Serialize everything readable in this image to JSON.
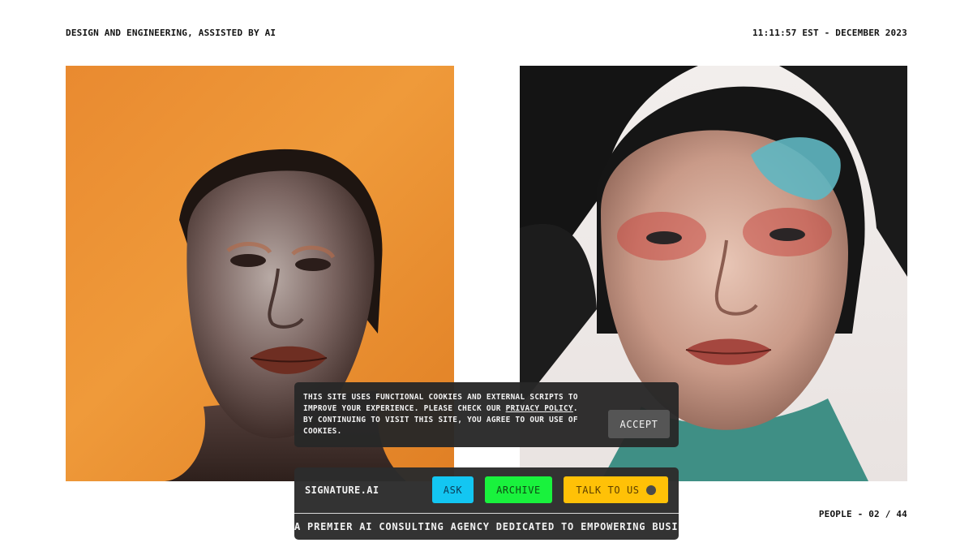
{
  "header": {
    "tagline": "DESIGN AND ENGINEERING, ASSISTED BY AI",
    "clock": "11:11:57 EST - DECEMBER 2023"
  },
  "gallery": {
    "counter": "PEOPLE - 02 / 44",
    "left_background": "#eb8f33",
    "right_background": "#f0ebe9"
  },
  "cookie": {
    "line1": "THIS SITE USES FUNCTIONAL COOKIES AND EXTERNAL SCRIPTS TO",
    "line2_prefix": "IMPROVE YOUR EXPERIENCE. PLEASE CHECK OUR ",
    "policy_link": "PRIVACY POLICY",
    "line2_suffix": ".",
    "line3": "BY CONTINUING TO VISIT THIS SITE, YOU AGREE TO OUR USE OF",
    "line4": "COOKIES.",
    "accept_label": "ACCEPT"
  },
  "nav": {
    "brand": "SIGNATURE.AI",
    "ask_label": "ASK",
    "archive_label": "ARCHIVE",
    "talk_label": "TALK TO US",
    "ticker": "A PREMIER AI CONSULTING AGENCY DEDICATED TO EMPOWERING BUSI",
    "colors": {
      "ask": "#13c6f2",
      "archive": "#19f23d",
      "talk": "#ffc107"
    }
  }
}
